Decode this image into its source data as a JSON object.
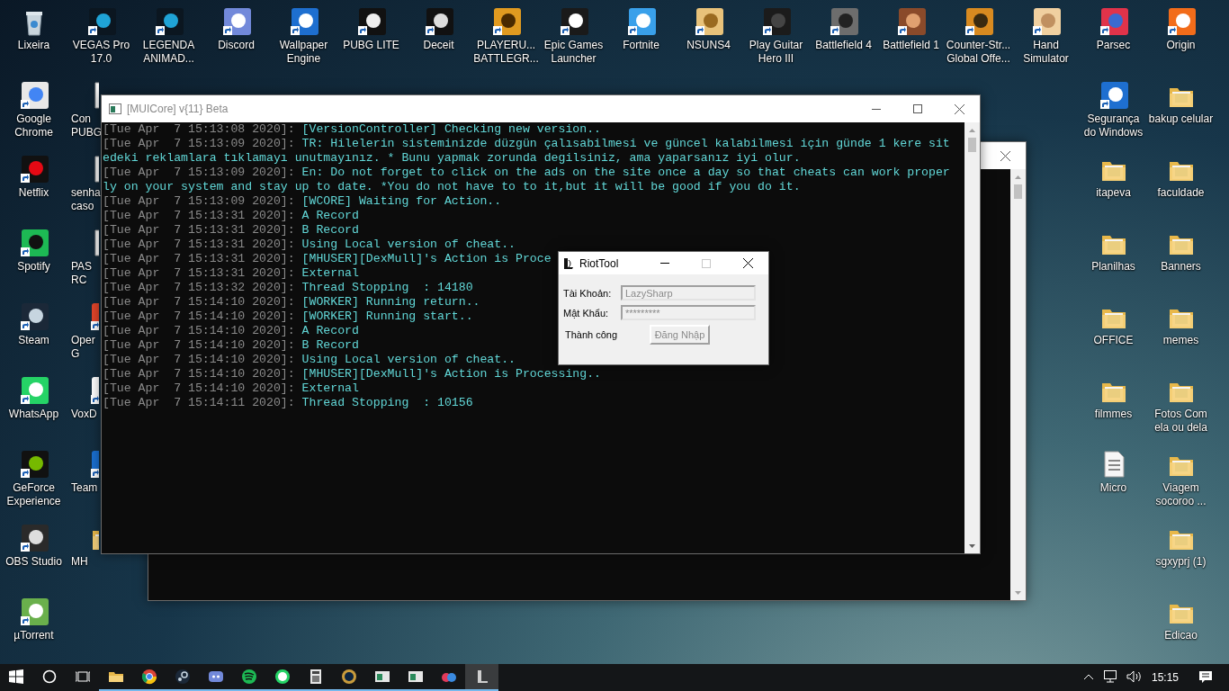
{
  "desktop": {
    "top_row": [
      {
        "kind": "bin",
        "label": "Lixeira"
      },
      {
        "kind": "shortcut",
        "label": "VEGAS Pro 17.0"
      },
      {
        "kind": "shortcut",
        "label": "LEGENDA ANIMAD..."
      },
      {
        "kind": "shortcut",
        "label": "Discord"
      },
      {
        "kind": "shortcut",
        "label": "Wallpaper Engine"
      },
      {
        "kind": "shortcut",
        "label": "PUBG LITE"
      },
      {
        "kind": "shortcut",
        "label": "Deceit"
      },
      {
        "kind": "shortcut",
        "label": "PLAYERU... BATTLEGR..."
      },
      {
        "kind": "shortcut",
        "label": "Epic Games Launcher"
      },
      {
        "kind": "shortcut",
        "label": "Fortnite"
      },
      {
        "kind": "shortcut",
        "label": "NSUNS4"
      },
      {
        "kind": "shortcut",
        "label": "Play Guitar Hero III"
      },
      {
        "kind": "shortcut",
        "label": "Battlefield 4"
      },
      {
        "kind": "shortcut",
        "label": "Battlefield 1"
      },
      {
        "kind": "shortcut",
        "label": "Counter-Str... Global Offe..."
      },
      {
        "kind": "shortcut",
        "label": "Hand Simulator"
      },
      {
        "kind": "shortcut",
        "label": "Parsec"
      },
      {
        "kind": "shortcut",
        "label": "Origin"
      }
    ],
    "left_column": [
      {
        "kind": "shortcut",
        "label": "Google Chrome"
      },
      {
        "kind": "shortcut",
        "label": "Netflix"
      },
      {
        "kind": "shortcut",
        "label": "Spotify"
      },
      {
        "kind": "shortcut",
        "label": "Steam"
      },
      {
        "kind": "shortcut",
        "label": "WhatsApp"
      },
      {
        "kind": "shortcut",
        "label": "GeForce Experience"
      },
      {
        "kind": "shortcut",
        "label": "OBS Studio"
      },
      {
        "kind": "shortcut",
        "label": "µTorrent"
      }
    ],
    "second_column": [
      {
        "kind": "file",
        "label": "Con PUBG"
      },
      {
        "kind": "file",
        "label": "senha caso"
      },
      {
        "kind": "file",
        "label": "PAS RC"
      },
      {
        "kind": "shortcut",
        "label": "Oper G"
      },
      {
        "kind": "shortcut",
        "label": "VoxD"
      },
      {
        "kind": "shortcut",
        "label": "Team"
      },
      {
        "kind": "folder",
        "label": "MH"
      }
    ],
    "right_column": [
      {
        "kind": "shortcut",
        "label": "Segurança do Windows"
      },
      {
        "kind": "folder",
        "label": "itapeva"
      },
      {
        "kind": "folder",
        "label": "Planilhas"
      },
      {
        "kind": "folder",
        "label": "OFFICE"
      },
      {
        "kind": "folder",
        "label": "filmmes"
      },
      {
        "kind": "file",
        "label": "Micro"
      }
    ],
    "far_right_column": [
      {
        "kind": "folder",
        "label": "bakup celular"
      },
      {
        "kind": "folder",
        "label": "faculdade"
      },
      {
        "kind": "folder",
        "label": "Banners"
      },
      {
        "kind": "folder",
        "label": "memes"
      },
      {
        "kind": "folder",
        "label": "Fotos Com ela ou dela"
      },
      {
        "kind": "folder",
        "label": "Viagem socoroo ..."
      },
      {
        "kind": "folder",
        "label": "sgxyprj (1)"
      },
      {
        "kind": "folder",
        "label": "Edicao"
      }
    ]
  },
  "console_window": {
    "title": "[MUICore] v{11} Beta",
    "lines": [
      {
        "time": "[Tue Apr  7 15:13:08 2020]:",
        "message": "[VersionController] Checking new version.."
      },
      {
        "time": "[Tue Apr  7 15:13:09 2020]:",
        "message": "TR: Hilelerin sisteminizde düzgün çalısabilmesi ve güncel kalabilmesi için günde 1 kere sitedeki reklamlara tıklamayı unutmayınız. * Bunu yapmak zorunda degilsiniz, ama yaparsanız iyi olur."
      },
      {
        "time": "[Tue Apr  7 15:13:09 2020]:",
        "message": "En: Do not forget to click on the ads on the site once a day so that cheats can work properly on your system and stay up to date. *You do not have to to it,but it will be good if you do it."
      },
      {
        "time": "[Tue Apr  7 15:13:09 2020]:",
        "message": "[WCORE] Waiting for Action.."
      },
      {
        "time": "[Tue Apr  7 15:13:31 2020]:",
        "message": "A Record"
      },
      {
        "time": "[Tue Apr  7 15:13:31 2020]:",
        "message": "B Record"
      },
      {
        "time": "[Tue Apr  7 15:13:31 2020]:",
        "message": "Using Local version of cheat.."
      },
      {
        "time": "[Tue Apr  7 15:13:31 2020]:",
        "message": "[MHUSER][DexMull]'s Action is Proce"
      },
      {
        "time": "[Tue Apr  7 15:13:31 2020]:",
        "message": "External"
      },
      {
        "time": "[Tue Apr  7 15:13:32 2020]:",
        "message": "Thread Stopping  : 14180"
      },
      {
        "time": "[Tue Apr  7 15:14:10 2020]:",
        "message": "[WORKER] Running return.."
      },
      {
        "time": "[Tue Apr  7 15:14:10 2020]:",
        "message": "[WORKER] Running start.."
      },
      {
        "time": "[Tue Apr  7 15:14:10 2020]:",
        "message": "A Record"
      },
      {
        "time": "[Tue Apr  7 15:14:10 2020]:",
        "message": "B Record"
      },
      {
        "time": "[Tue Apr  7 15:14:10 2020]:",
        "message": "Using Local version of cheat.."
      },
      {
        "time": "[Tue Apr  7 15:14:10 2020]:",
        "message": "[MHUSER][DexMull]'s Action is Processing.."
      },
      {
        "time": "[Tue Apr  7 15:14:10 2020]:",
        "message": "External"
      },
      {
        "time": "[Tue Apr  7 15:14:11 2020]:",
        "message": "Thread Stopping  : 10156"
      }
    ]
  },
  "login_dialog": {
    "title": "RiotTool",
    "fields": [
      {
        "label": "Tài Khoản:",
        "value": "LazySharp",
        "disabled": true
      },
      {
        "label": "Mật Khẩu:",
        "value": "*********",
        "disabled": true
      }
    ],
    "status": "Thành công",
    "button": {
      "label": "Đăng Nhập",
      "disabled": true
    }
  },
  "taskbar": {
    "apps": [
      {
        "running": true,
        "selected": false
      },
      {
        "running": true,
        "selected": false
      },
      {
        "running": true,
        "selected": false
      },
      {
        "running": true,
        "selected": false
      },
      {
        "running": true,
        "selected": false
      },
      {
        "running": true,
        "selected": false
      },
      {
        "running": true,
        "selected": false
      },
      {
        "running": true,
        "selected": false
      },
      {
        "running": true,
        "selected": false
      },
      {
        "running": true,
        "selected": false
      },
      {
        "running": true,
        "selected": false
      },
      {
        "running": true,
        "selected": true
      }
    ],
    "clock": "15:15"
  }
}
